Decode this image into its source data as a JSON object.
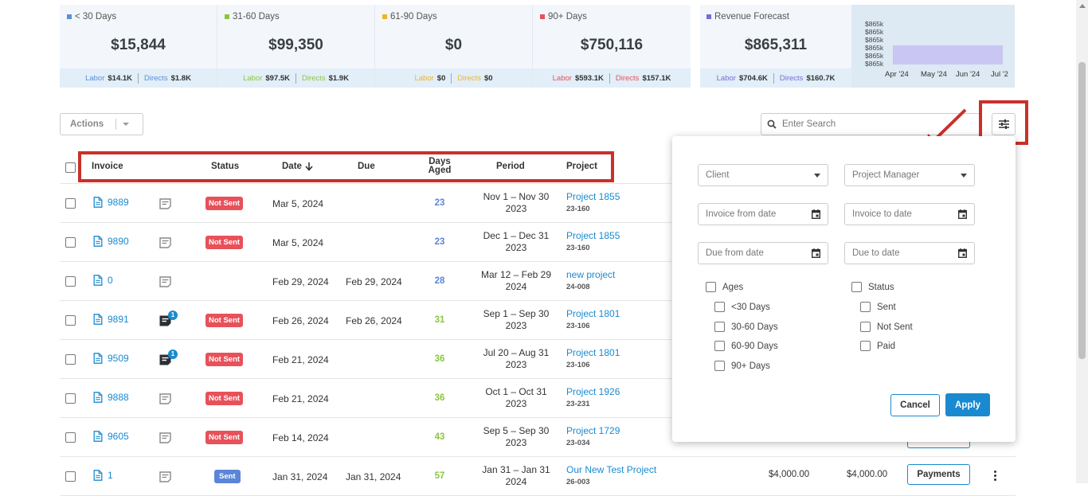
{
  "colors": {
    "lt30": "#5b8fd8",
    "d3160": "#8cc63f",
    "d6190": "#f0b429",
    "d90": "#e8515a",
    "forecast": "#7b6bd6",
    "link": "#1a8ad0",
    "highlight": "#c8312a"
  },
  "summary": [
    {
      "label": "< 30 Days",
      "amount": "$15,844",
      "labor_label": "Labor",
      "labor": "$14.1K",
      "directs_label": "Directs",
      "directs": "$1.8K"
    },
    {
      "label": "31-60 Days",
      "amount": "$99,350",
      "labor_label": "Labor",
      "labor": "$97.5K",
      "directs_label": "Directs",
      "directs": "$1.9K"
    },
    {
      "label": "61-90 Days",
      "amount": "$0",
      "labor_label": "Labor",
      "labor": "$0",
      "directs_label": "Directs",
      "directs": "$0"
    },
    {
      "label": "90+ Days",
      "amount": "$750,116",
      "labor_label": "Labor",
      "labor": "$593.1K",
      "directs_label": "Directs",
      "directs": "$157.1K"
    }
  ],
  "forecast": {
    "label": "Revenue Forecast",
    "amount": "$865,311",
    "labor_label": "Labor",
    "labor": "$704.6K",
    "directs_label": "Directs",
    "directs": "$160.7K",
    "y_ticks": [
      "$865k",
      "$865k",
      "$865k",
      "$865k",
      "$865k",
      "$865k"
    ],
    "x_ticks": [
      "Apr '24",
      "May '24",
      "Jun '24",
      "Jul '2"
    ]
  },
  "toolbar": {
    "actions_label": "Actions",
    "search_placeholder": "Enter Search"
  },
  "table": {
    "headers": {
      "invoice": "Invoice",
      "status": "Status",
      "date": "Date",
      "due": "Due",
      "days_aged": "Days\nAged",
      "period": "Period",
      "project": "Project"
    },
    "rows": [
      {
        "invoice": "9889",
        "has_note": false,
        "status": "Not Sent",
        "date": "Mar 5, 2024",
        "due": "",
        "aged": "23",
        "aged_color": "#5b85d9",
        "period_1": "Nov 1 – Nov 30",
        "period_2": "2023",
        "project": "Project 1855",
        "code": "23-160"
      },
      {
        "invoice": "9890",
        "has_note": false,
        "status": "Not Sent",
        "date": "Mar 5, 2024",
        "due": "",
        "aged": "23",
        "aged_color": "#5b85d9",
        "period_1": "Dec 1 – Dec 31",
        "period_2": "2023",
        "project": "Project 1855",
        "code": "23-160"
      },
      {
        "invoice": "0",
        "has_note": false,
        "status": "",
        "date": "Feb 29, 2024",
        "due": "Feb 29, 2024",
        "aged": "28",
        "aged_color": "#5b85d9",
        "period_1": "Mar 12 – Feb 29",
        "period_2": "2024",
        "project": "new project",
        "code": "24-008"
      },
      {
        "invoice": "9891",
        "has_note": true,
        "note_count": "1",
        "status": "Not Sent",
        "date": "Feb 26, 2024",
        "due": "Feb 26, 2024",
        "aged": "31",
        "aged_color": "#8cc63f",
        "period_1": "Sep 1 – Sep 30",
        "period_2": "2023",
        "project": "Project 1801",
        "code": "23-106"
      },
      {
        "invoice": "9509",
        "has_note": true,
        "note_count": "1",
        "status": "Not Sent",
        "date": "Feb 21, 2024",
        "due": "",
        "aged": "36",
        "aged_color": "#8cc63f",
        "period_1": "Jul 20 – Aug 31",
        "period_2": "2023",
        "project": "Project 1801",
        "code": "23-106"
      },
      {
        "invoice": "9888",
        "has_note": false,
        "status": "Not Sent",
        "date": "Feb 21, 2024",
        "due": "",
        "aged": "36",
        "aged_color": "#8cc63f",
        "period_1": "Oct 1 – Oct 31",
        "period_2": "2023",
        "project": "Project 1926",
        "code": "23-231"
      },
      {
        "invoice": "9605",
        "has_note": false,
        "status": "Not Sent",
        "date": "Feb 14, 2024",
        "due": "",
        "aged": "43",
        "aged_color": "#8cc63f",
        "period_1": "Sep 5 – Sep 30",
        "period_2": "2023",
        "project": "Project 1729",
        "code": "23-034"
      },
      {
        "invoice": "1",
        "has_note": false,
        "status": "Sent",
        "date": "Jan 31, 2024",
        "due": "Jan 31, 2024",
        "aged": "57",
        "aged_color": "#8cc63f",
        "period_1": "Jan 31 – Jan 31",
        "period_2": "2024",
        "project": "Our New Test Project",
        "code": "26-003",
        "amount_1": "$4,000.00",
        "amount_2": "$4,000.00",
        "payments_label": "Payments"
      }
    ]
  },
  "filter": {
    "client_placeholder": "Client",
    "pm_placeholder": "Project Manager",
    "invoice_from": "Invoice from date",
    "invoice_to": "Invoice to date",
    "due_from": "Due from date",
    "due_to": "Due to date",
    "ages_label": "Ages",
    "ages": [
      "<30 Days",
      "30-60 Days",
      "60-90 Days",
      "90+ Days"
    ],
    "status_label": "Status",
    "statuses": [
      "Sent",
      "Not Sent",
      "Paid"
    ],
    "cancel": "Cancel",
    "apply": "Apply"
  }
}
